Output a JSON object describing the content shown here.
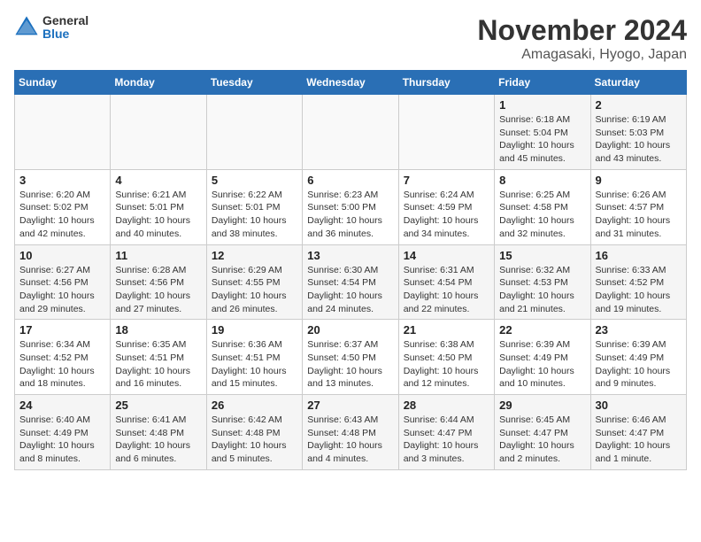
{
  "logo": {
    "general": "General",
    "blue": "Blue"
  },
  "title": "November 2024",
  "subtitle": "Amagasaki, Hyogo, Japan",
  "days_of_week": [
    "Sunday",
    "Monday",
    "Tuesday",
    "Wednesday",
    "Thursday",
    "Friday",
    "Saturday"
  ],
  "weeks": [
    [
      {
        "day": "",
        "info": ""
      },
      {
        "day": "",
        "info": ""
      },
      {
        "day": "",
        "info": ""
      },
      {
        "day": "",
        "info": ""
      },
      {
        "day": "",
        "info": ""
      },
      {
        "day": "1",
        "info": "Sunrise: 6:18 AM\nSunset: 5:04 PM\nDaylight: 10 hours and 45 minutes."
      },
      {
        "day": "2",
        "info": "Sunrise: 6:19 AM\nSunset: 5:03 PM\nDaylight: 10 hours and 43 minutes."
      }
    ],
    [
      {
        "day": "3",
        "info": "Sunrise: 6:20 AM\nSunset: 5:02 PM\nDaylight: 10 hours and 42 minutes."
      },
      {
        "day": "4",
        "info": "Sunrise: 6:21 AM\nSunset: 5:01 PM\nDaylight: 10 hours and 40 minutes."
      },
      {
        "day": "5",
        "info": "Sunrise: 6:22 AM\nSunset: 5:01 PM\nDaylight: 10 hours and 38 minutes."
      },
      {
        "day": "6",
        "info": "Sunrise: 6:23 AM\nSunset: 5:00 PM\nDaylight: 10 hours and 36 minutes."
      },
      {
        "day": "7",
        "info": "Sunrise: 6:24 AM\nSunset: 4:59 PM\nDaylight: 10 hours and 34 minutes."
      },
      {
        "day": "8",
        "info": "Sunrise: 6:25 AM\nSunset: 4:58 PM\nDaylight: 10 hours and 32 minutes."
      },
      {
        "day": "9",
        "info": "Sunrise: 6:26 AM\nSunset: 4:57 PM\nDaylight: 10 hours and 31 minutes."
      }
    ],
    [
      {
        "day": "10",
        "info": "Sunrise: 6:27 AM\nSunset: 4:56 PM\nDaylight: 10 hours and 29 minutes."
      },
      {
        "day": "11",
        "info": "Sunrise: 6:28 AM\nSunset: 4:56 PM\nDaylight: 10 hours and 27 minutes."
      },
      {
        "day": "12",
        "info": "Sunrise: 6:29 AM\nSunset: 4:55 PM\nDaylight: 10 hours and 26 minutes."
      },
      {
        "day": "13",
        "info": "Sunrise: 6:30 AM\nSunset: 4:54 PM\nDaylight: 10 hours and 24 minutes."
      },
      {
        "day": "14",
        "info": "Sunrise: 6:31 AM\nSunset: 4:54 PM\nDaylight: 10 hours and 22 minutes."
      },
      {
        "day": "15",
        "info": "Sunrise: 6:32 AM\nSunset: 4:53 PM\nDaylight: 10 hours and 21 minutes."
      },
      {
        "day": "16",
        "info": "Sunrise: 6:33 AM\nSunset: 4:52 PM\nDaylight: 10 hours and 19 minutes."
      }
    ],
    [
      {
        "day": "17",
        "info": "Sunrise: 6:34 AM\nSunset: 4:52 PM\nDaylight: 10 hours and 18 minutes."
      },
      {
        "day": "18",
        "info": "Sunrise: 6:35 AM\nSunset: 4:51 PM\nDaylight: 10 hours and 16 minutes."
      },
      {
        "day": "19",
        "info": "Sunrise: 6:36 AM\nSunset: 4:51 PM\nDaylight: 10 hours and 15 minutes."
      },
      {
        "day": "20",
        "info": "Sunrise: 6:37 AM\nSunset: 4:50 PM\nDaylight: 10 hours and 13 minutes."
      },
      {
        "day": "21",
        "info": "Sunrise: 6:38 AM\nSunset: 4:50 PM\nDaylight: 10 hours and 12 minutes."
      },
      {
        "day": "22",
        "info": "Sunrise: 6:39 AM\nSunset: 4:49 PM\nDaylight: 10 hours and 10 minutes."
      },
      {
        "day": "23",
        "info": "Sunrise: 6:39 AM\nSunset: 4:49 PM\nDaylight: 10 hours and 9 minutes."
      }
    ],
    [
      {
        "day": "24",
        "info": "Sunrise: 6:40 AM\nSunset: 4:49 PM\nDaylight: 10 hours and 8 minutes."
      },
      {
        "day": "25",
        "info": "Sunrise: 6:41 AM\nSunset: 4:48 PM\nDaylight: 10 hours and 6 minutes."
      },
      {
        "day": "26",
        "info": "Sunrise: 6:42 AM\nSunset: 4:48 PM\nDaylight: 10 hours and 5 minutes."
      },
      {
        "day": "27",
        "info": "Sunrise: 6:43 AM\nSunset: 4:48 PM\nDaylight: 10 hours and 4 minutes."
      },
      {
        "day": "28",
        "info": "Sunrise: 6:44 AM\nSunset: 4:47 PM\nDaylight: 10 hours and 3 minutes."
      },
      {
        "day": "29",
        "info": "Sunrise: 6:45 AM\nSunset: 4:47 PM\nDaylight: 10 hours and 2 minutes."
      },
      {
        "day": "30",
        "info": "Sunrise: 6:46 AM\nSunset: 4:47 PM\nDaylight: 10 hours and 1 minute."
      }
    ]
  ]
}
